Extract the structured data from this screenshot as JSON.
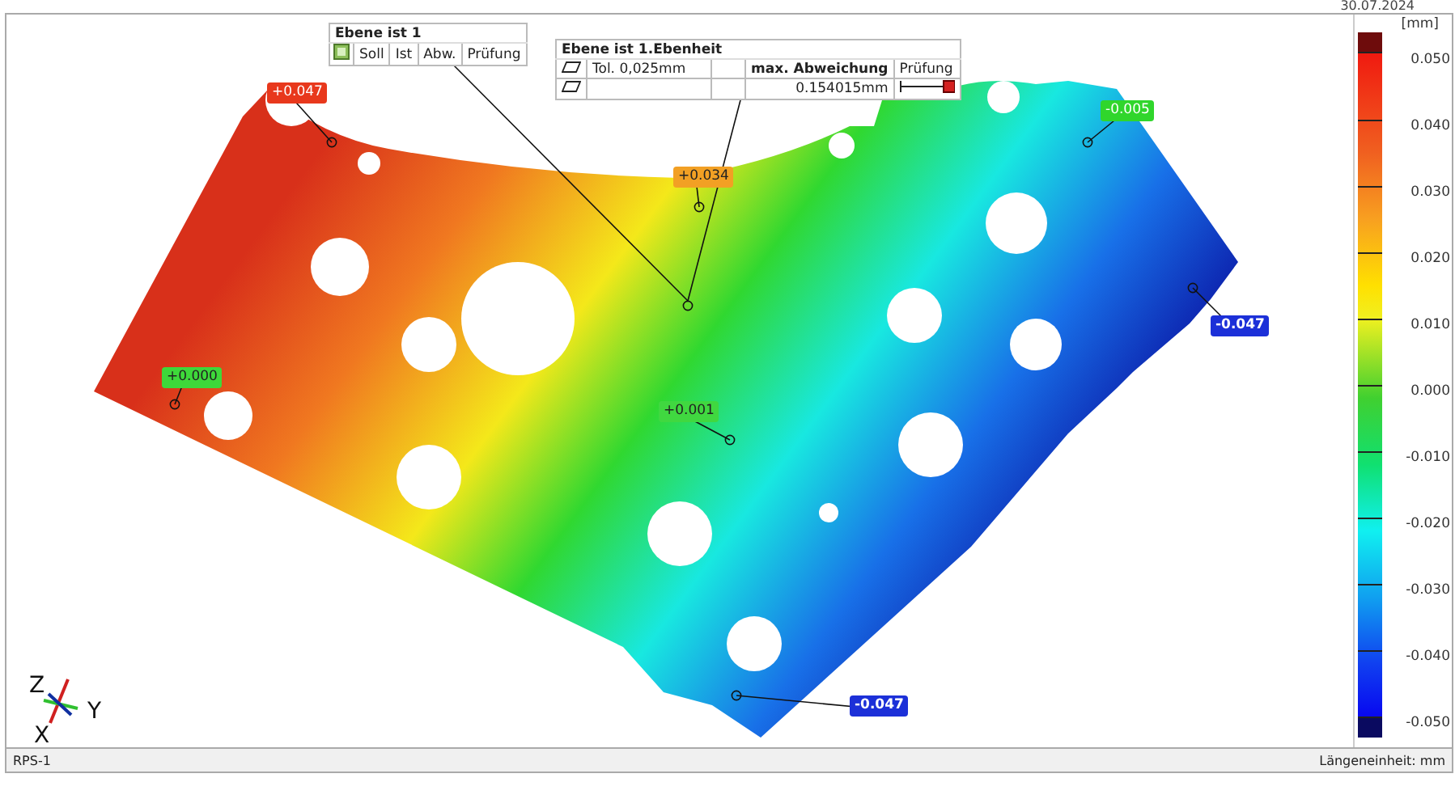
{
  "date": "30.07.2024",
  "viewport": {
    "info_tables": [
      {
        "title": "Ebene ist 1",
        "rows": [
          [
            {
              "kind": "square"
            },
            {
              "kind": "text",
              "text": "Soll",
              "bold": false
            },
            {
              "kind": "text",
              "text": "Ist",
              "bold": false
            },
            {
              "kind": "text",
              "text": "Abw.",
              "bold": false
            },
            {
              "kind": "text",
              "text": "Prüfung",
              "bold": false
            }
          ]
        ]
      },
      {
        "title": "Ebene ist 1.Ebenheit",
        "rows": [
          [
            {
              "kind": "flatness"
            },
            {
              "kind": "text",
              "text": "Tol. 0,025mm",
              "bold": false
            },
            {
              "kind": "empty"
            },
            {
              "kind": "text",
              "text": "max. Abweichung",
              "bold": true
            },
            {
              "kind": "text",
              "text": "Prüfung",
              "bold": false
            }
          ],
          [
            {
              "kind": "flatness"
            },
            {
              "kind": "empty"
            },
            {
              "kind": "empty"
            },
            {
              "kind": "text",
              "text": "0.154015mm",
              "bold": false
            },
            {
              "kind": "gauge"
            }
          ]
        ]
      }
    ],
    "labels": [
      {
        "text": "+0.047",
        "color": "#e8381c"
      },
      {
        "text": "+0.034",
        "color": "#f2a024"
      },
      {
        "text": "-0.005",
        "color": "#30d62c"
      },
      {
        "text": "-0.047",
        "color": "#1c30d8"
      },
      {
        "text": "+0.000",
        "color": "#3ed83a"
      },
      {
        "text": "+0.001",
        "color": "#40d840"
      },
      {
        "text": "-0.047",
        "color": "#1c30d8"
      }
    ],
    "axes": [
      "Z",
      "Y",
      "X"
    ]
  },
  "legend": {
    "unit": "[mm]",
    "ticks": [
      "0.050",
      "0.040",
      "0.030",
      "0.020",
      "0.010",
      "0.000",
      "-0.010",
      "-0.020",
      "-0.030",
      "-0.040",
      "-0.050"
    ]
  },
  "status_bar": {
    "left": "RPS-1",
    "right": "Längeneinheit: mm"
  }
}
